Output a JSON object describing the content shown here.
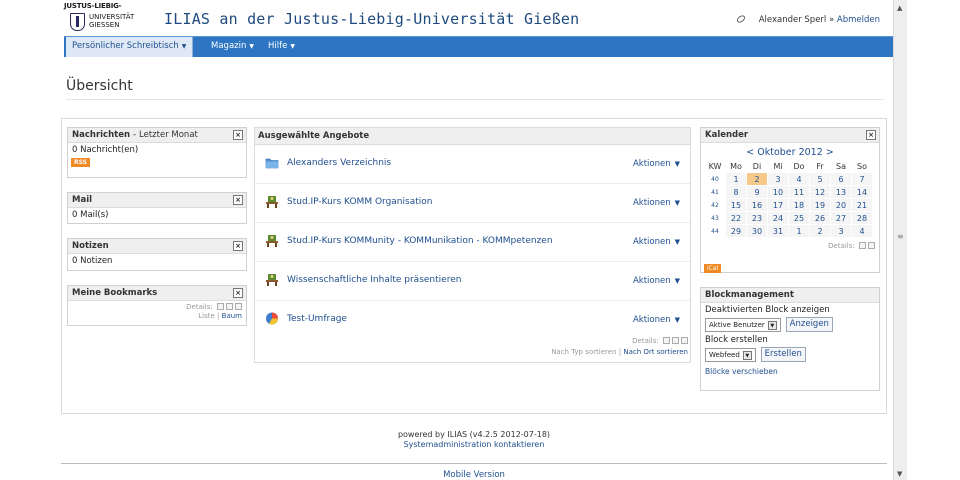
{
  "header": {
    "logo_line1": "JUSTUS-LIEBIG-",
    "logo_line2": "UNIVERSITÄT",
    "logo_line3": "GIESSEN",
    "title": "ILIAS an der Justus-Liebig-Universität Gießen",
    "user_name": "Alexander Sperl",
    "separator": "»",
    "logout_label": "Abmelden"
  },
  "nav": {
    "items": [
      {
        "label": "Persönlicher Schreibtisch"
      },
      {
        "label": "Magazin"
      },
      {
        "label": "Hilfe"
      }
    ]
  },
  "page_title": "Übersicht",
  "left": {
    "news": {
      "title": "Nachrichten",
      "dash": "-",
      "subtitle": "Letzter Monat",
      "value": "0 Nachricht(en)",
      "rss_label": "RSS"
    },
    "mail": {
      "title": "Mail",
      "value": "0 Mail(s)"
    },
    "notes": {
      "title": "Notizen",
      "value": "0 Notizen"
    },
    "bookmarks": {
      "title": "Meine Bookmarks",
      "details_label": "Details:",
      "list_label": "Liste",
      "link_sep": "|",
      "tree_label": "Baum"
    }
  },
  "center": {
    "title": "Ausgewählte Angebote",
    "items": [
      {
        "title": "Alexanders Verzeichnis",
        "icon": "folder-icon",
        "action": "Aktionen"
      },
      {
        "title": "Stud.IP-Kurs KOMM Organisation",
        "icon": "course-icon",
        "action": "Aktionen"
      },
      {
        "title": "Stud.IP-Kurs KOMMunity - KOMMunikation - KOMMpetenzen",
        "icon": "course-icon",
        "action": "Aktionen"
      },
      {
        "title": "Wissenschaftliche Inhalte präsentieren",
        "icon": "course-icon",
        "action": "Aktionen"
      },
      {
        "title": "Test-Umfrage",
        "icon": "survey-icon",
        "action": "Aktionen"
      }
    ],
    "details_label": "Details:",
    "sort_type": "Nach Typ sortieren",
    "sort_sep": "|",
    "sort_location": "Nach Ort sortieren"
  },
  "calendar": {
    "title": "Kalender",
    "prev": "<",
    "month": "Oktober 2012",
    "next": ">",
    "headers": [
      "KW",
      "Mo",
      "Di",
      "Mi",
      "Do",
      "Fr",
      "Sa",
      "So"
    ],
    "weeks": [
      {
        "kw": "40",
        "days": [
          "1",
          "2",
          "3",
          "4",
          "5",
          "6",
          "7"
        ]
      },
      {
        "kw": "41",
        "days": [
          "8",
          "9",
          "10",
          "11",
          "12",
          "13",
          "14"
        ]
      },
      {
        "kw": "42",
        "days": [
          "15",
          "16",
          "17",
          "18",
          "19",
          "20",
          "21"
        ]
      },
      {
        "kw": "43",
        "days": [
          "22",
          "23",
          "24",
          "25",
          "26",
          "27",
          "28"
        ]
      },
      {
        "kw": "44",
        "days": [
          "29",
          "30",
          "31",
          "1",
          "2",
          "3",
          "4"
        ]
      }
    ],
    "today": "2",
    "details_label": "Details:",
    "ical_label": "iCal"
  },
  "blockmanagement": {
    "title": "Blockmanagement",
    "deactivated_label": "Deaktivierten Block anzeigen",
    "deactivated_value": "Aktive Benutzer",
    "show_button": "Anzeigen",
    "create_label": "Block erstellen",
    "create_value": "Webfeed",
    "create_button": "Erstellen",
    "move_label": "Blöcke verschieben"
  },
  "footer": {
    "powered": "powered by ILIAS (v4.2.5 2012-07-18)",
    "admin_contact": "Systemadministration kontaktieren",
    "mobile": "Mobile Version"
  },
  "colors": {
    "nav": "#2e76c4",
    "link": "#1f4f8f",
    "rss": "#f08a24",
    "today": "#f5c98a"
  }
}
